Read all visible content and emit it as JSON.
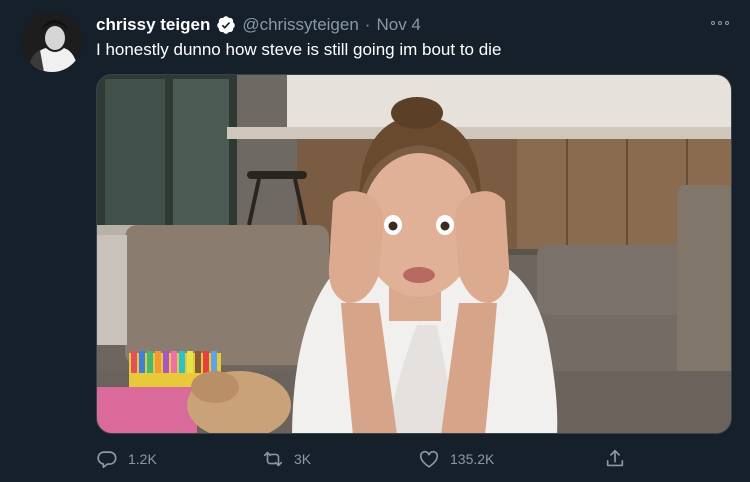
{
  "tweet": {
    "author_name": "chrissy teigen",
    "handle": "@chrissyteigen",
    "separator": "·",
    "time": "Nov 4",
    "text": "I honestly dunno how steve is still going im bout to die"
  },
  "icons": {
    "verified": "verified-badge-icon",
    "more": "more-options-icon",
    "reply": "reply-icon",
    "retweet": "retweet-icon",
    "like": "heart-icon",
    "share": "share-icon"
  },
  "actions": {
    "reply_count": "1.2K",
    "retweet_count": "3K",
    "like_count": "135.2K"
  },
  "colors": {
    "background": "#15202b",
    "secondary_text": "#8899a6",
    "verified": "#ffffff"
  }
}
